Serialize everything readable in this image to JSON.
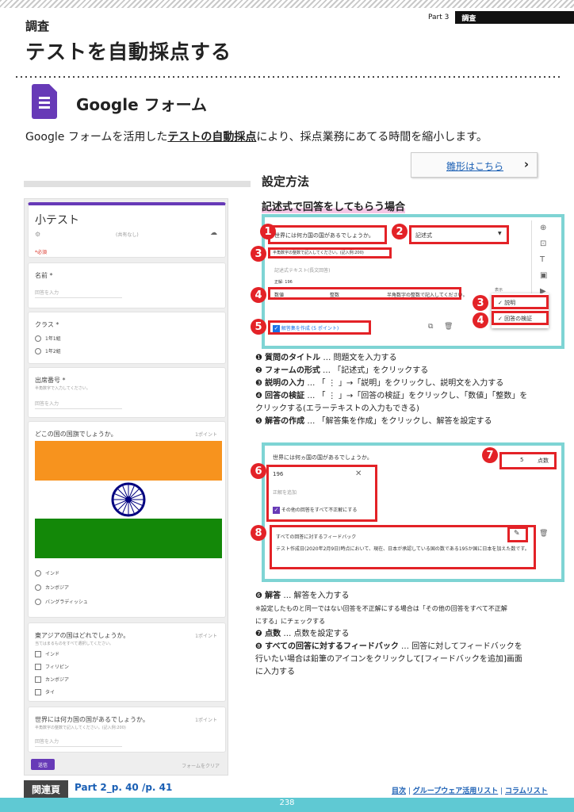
{
  "header": {
    "part_label": "Part 3",
    "part_name": "調査",
    "category": "調査",
    "title": "テストを自動採点する"
  },
  "app": {
    "name": "Google フォーム",
    "brand_color": "#673ab7",
    "icon": "google-forms-icon"
  },
  "intro": {
    "before": "Google フォームを活用した",
    "highlight": "テストの自動採点",
    "after": "により、採点業務にあてる時間を縮小します。"
  },
  "template_link": {
    "label": "雛形はこちら",
    "icon": "chevron-right-icon"
  },
  "section": {
    "heading": "設定方法",
    "subheading": "記述式で回答をしてもらう場合"
  },
  "form": {
    "title": "小テスト",
    "account_note": "(共有なし)",
    "required_note": "*必須",
    "fields": [
      {
        "label": "名前 *",
        "placeholder": "回答を入力"
      },
      {
        "label": "クラス *",
        "options": [
          "1年1組",
          "1年2組"
        ]
      },
      {
        "label": "出席番号 *",
        "hint": "半角数字で入力してください。",
        "placeholder": "回答を入力"
      }
    ],
    "question1": {
      "label": "どこの国の国旗でしょうか。",
      "points": "1ポイント",
      "options": [
        "インド",
        "カンボジア",
        "バングラディッシュ"
      ]
    },
    "question2": {
      "label": "東アジアの国はどれでしょうか。",
      "hint": "当てはまるものをすべて選択してください。",
      "points": "1ポイント",
      "options": [
        "インド",
        "フィリピン",
        "カンボジア",
        "タイ"
      ]
    },
    "question3": {
      "label": "世界には何カ国の国があるでしょうか。",
      "hint": "半角数字の整数で記入してください。(記入例:200)",
      "points": "1ポイント",
      "placeholder": "回答を入力"
    },
    "submit": "送信",
    "clear": "フォームをクリア"
  },
  "screenshot1": {
    "question": "世界には何カ国の国があるでしょうか。",
    "type": "記述式",
    "description": "半角数字の整数で記入してください。(記入例:200)",
    "answer_placeholder": "記述式テキスト(長文回答)",
    "correct_label": "正解: 196",
    "validation": [
      "数値",
      "整数",
      "半角数字の整数で記入してください。"
    ],
    "menu_title": "表示",
    "menu_items": [
      "説明",
      "回答の検証"
    ],
    "answer_key": "解答集を作成",
    "answer_key_points": "(5 ポイント)"
  },
  "steps1": [
    {
      "num": "❶",
      "title": "質問のタイトル",
      "text": " … 問題文を入力する"
    },
    {
      "num": "❷",
      "title": "フォームの形式",
      "text": " … 「記述式」をクリックする"
    },
    {
      "num": "❸",
      "title": "説明の入力",
      "text": " … 「 ⋮ 」→「説明」をクリックし、説明文を入力する"
    },
    {
      "num": "❹",
      "title": "回答の検証",
      "text": " … 「 ⋮ 」→「回答の検証」をクリックし、「数値」「整数」を"
    },
    {
      "num": "",
      "title": "",
      "text": "クリックする(エラーテキストの入力もできる)"
    },
    {
      "num": "❺",
      "title": "解答の作成",
      "text": " … 「解答集を作成」をクリックし、解答を設定する"
    }
  ],
  "screenshot2": {
    "question": "世界には何ヵ国の国があるでしょうか。",
    "points_value": "5",
    "points_unit": "点数",
    "answer": "196",
    "add_answer": "正解を追加",
    "mark_others": "その他の回答をすべて不正解にする",
    "feedback_title": "すべての回答に対するフィードバック",
    "feedback_text": "テスト作成日(2020年2月9日)時点において、現在、日本が承認している国の数である195か国に日本を加えた数です。"
  },
  "steps2": [
    {
      "num": "❻",
      "title": "解答",
      "text": " … 解答を入力する"
    },
    {
      "num": "",
      "title": "",
      "text": "※設定したものと同一ではない回答を不正解にする場合は「その他の回答をすべて不正解"
    },
    {
      "num": "",
      "title": "",
      "text": "にする」にチェックする"
    },
    {
      "num": "❼",
      "title": "点数",
      "text": " … 点数を設定する"
    },
    {
      "num": "❽",
      "title": "すべての回答に対するフィードバック",
      "text": " … 回答に対してフィードバックを"
    },
    {
      "num": "",
      "title": "",
      "text": "行いたい場合は鉛筆のアイコンをクリックして[フィードバックを追加]画面"
    },
    {
      "num": "",
      "title": "",
      "text": "に入力する"
    }
  ],
  "footer": {
    "related_label": "関連頁",
    "related_text": "Part 2_p. 40 /p. 41",
    "links": [
      "目次",
      "グループウェア活用リスト",
      "コラムリスト"
    ],
    "page_number": "238"
  }
}
